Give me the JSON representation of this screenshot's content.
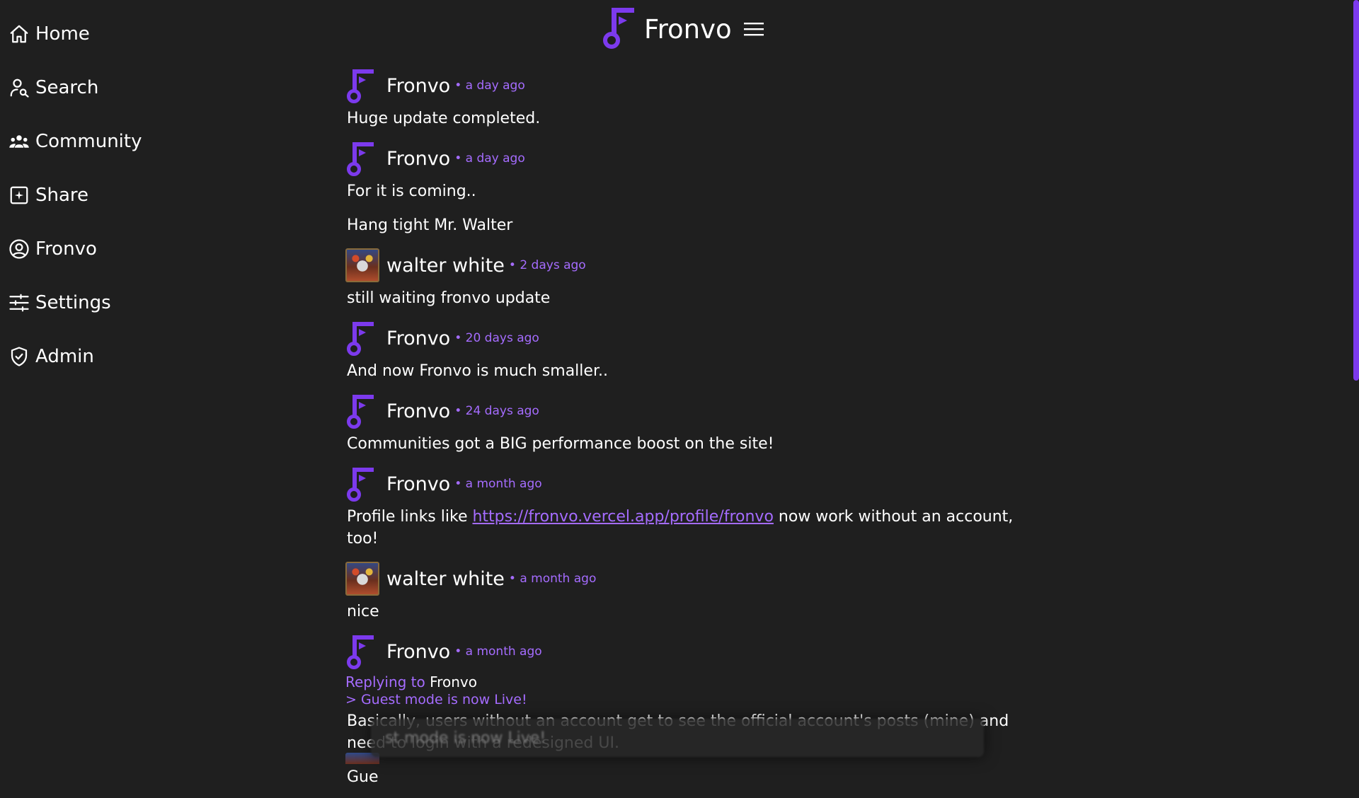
{
  "brand": {
    "title": "Fronvo",
    "accent": "#7c3aed"
  },
  "sidebar": {
    "items": [
      {
        "label": "Home",
        "icon": "home-icon"
      },
      {
        "label": "Search",
        "icon": "user-search-icon"
      },
      {
        "label": "Community",
        "icon": "users-icon"
      },
      {
        "label": "Share",
        "icon": "square-plus-icon"
      },
      {
        "label": "Fronvo",
        "icon": "user-circle-icon"
      },
      {
        "label": "Settings",
        "icon": "sliders-icon"
      },
      {
        "label": "Admin",
        "icon": "shield-check-icon"
      }
    ]
  },
  "posts": [
    {
      "author": "Fronvo",
      "time": "• a day ago",
      "paragraphs": [
        "Huge update completed."
      ]
    },
    {
      "author": "Fronvo",
      "time": "• a day ago",
      "paragraphs": [
        "For it is coming..",
        "Hang tight Mr. Walter"
      ]
    },
    {
      "author": "walter white",
      "time": "• 2 days ago",
      "paragraphs": [
        "still waiting fronvo update"
      ]
    },
    {
      "author": "Fronvo",
      "time": "• 20 days ago",
      "paragraphs": [
        "And now Fronvo is much smaller.."
      ]
    },
    {
      "author": "Fronvo",
      "time": "• 24 days ago",
      "paragraphs": [
        "Communities got a BIG performance boost on the site!"
      ]
    },
    {
      "author": "Fronvo",
      "time": "• a month ago",
      "link_prefix": "Profile links like ",
      "link": "https://fronvo.vercel.app/profile/fronvo",
      "link_suffix": " now work without an account, too!"
    },
    {
      "author": "walter white",
      "time": "• a month ago",
      "paragraphs": [
        "nice"
      ]
    },
    {
      "author": "Fronvo",
      "time": "• a month ago",
      "reply_label": "Replying to",
      "reply_name": "Fronvo",
      "quote": "> Guest mode is now Live!",
      "paragraphs": [
        "Basically, users without an account get to see the official account's posts (mine) and need to login with a redesigned UI.",
        "Gue"
      ]
    }
  ],
  "toast": {
    "text": "st mode is now Live!"
  }
}
